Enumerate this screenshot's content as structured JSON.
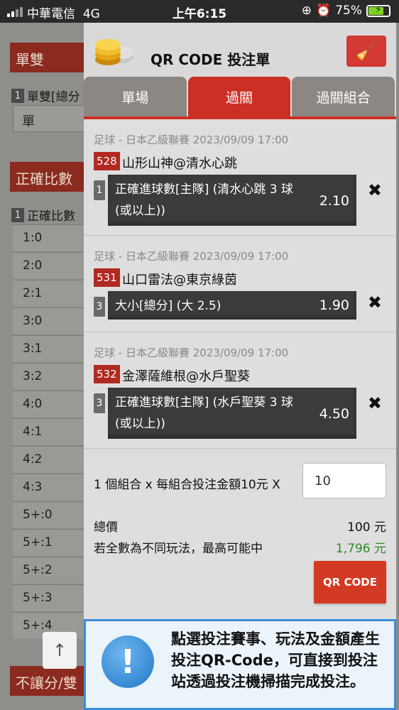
{
  "status_bar": {
    "carrier": "中華電信",
    "network": "4G",
    "time": "上午6:15",
    "battery": "75%",
    "battery_level": 0.75
  },
  "background": {
    "section1_title": "單雙",
    "section1_sub_num": "1",
    "section1_sub_label": "單雙[總分",
    "section1_box": "單",
    "section2_title": "正確比數",
    "section2_sub_num": "1",
    "section2_sub_label": "正確比數",
    "scores": [
      "1:0",
      "2:0",
      "2:1",
      "3:0",
      "3:1",
      "3:2",
      "4:0",
      "4:1",
      "4:2",
      "4:3",
      "5+:0",
      "5+:1",
      "5+:2",
      "5+:3",
      "5+:4"
    ],
    "section3_title": "不讓分/雙",
    "scroll_top": "↑"
  },
  "panel": {
    "title": "QR CODE 投注單",
    "clear_icon": "broom-icon",
    "tabs": [
      "單場",
      "過關",
      "過關組合"
    ],
    "active_tab": 1,
    "bets": [
      {
        "league": "足球 - 日本乙級聯賽 2023/09/09 17:00",
        "code": "528",
        "match": "山形山神@清水心跳",
        "sel_num": "1",
        "selection_line1": "正確進球數[主隊] (清水心跳 3 球",
        "selection_line2": "(或以上))",
        "odds": "2.10"
      },
      {
        "league": "足球 - 日本乙級聯賽 2023/09/09 17:00",
        "code": "531",
        "match": "山口雷法@東京綠茵",
        "sel_num": "3",
        "selection_line1": "大小[總分] (大 2.5)",
        "selection_line2": "",
        "odds": "1.90"
      },
      {
        "league": "足球 - 日本乙級聯賽 2023/09/09 17:00",
        "code": "532",
        "match": "金澤薩維根@水戶聖葵",
        "sel_num": "3",
        "selection_line1": "正確進球數[主隊] (水戶聖葵 3 球",
        "selection_line2": "(或以上))",
        "odds": "4.50"
      }
    ],
    "remove_glyph": "✖",
    "combo_text": "1 個組合 x 每組合投注金額10元 X",
    "amount_value": "10",
    "total_label": "總價",
    "total_value": "100 元",
    "max_label": "若全數為不同玩法，最高可能中",
    "max_value": "1,796 元",
    "qr_button": "QR CODE",
    "info_text": "點選投注賽事、玩法及金額產生投注QR-Code，可直接到投注站透過投注機掃描完成投注。"
  },
  "colors": {
    "accent_red": "#cc2f24",
    "tab_inactive": "#8d8784",
    "info_border": "#3a8fd8",
    "win_green": "#2f8a2a"
  }
}
